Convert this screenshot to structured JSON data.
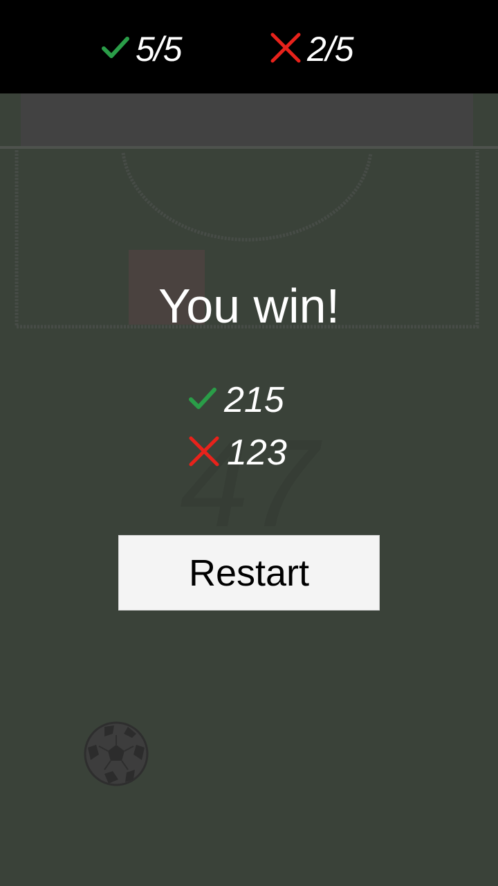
{
  "top_bar": {
    "hits": {
      "icon": "check-icon",
      "value": "5/5",
      "color": "#2a9d48"
    },
    "misses": {
      "icon": "cross-icon",
      "value": "2/5",
      "color": "#e8221b"
    }
  },
  "result": {
    "title": "You win!",
    "final_hits": {
      "icon": "check-icon",
      "value": "215"
    },
    "final_misses": {
      "icon": "cross-icon",
      "value": "123"
    }
  },
  "restart": {
    "label": "Restart"
  },
  "pitch": {
    "background_color": "#3a4239",
    "faded_number": "47",
    "ball_icon": "soccer-ball-icon"
  }
}
